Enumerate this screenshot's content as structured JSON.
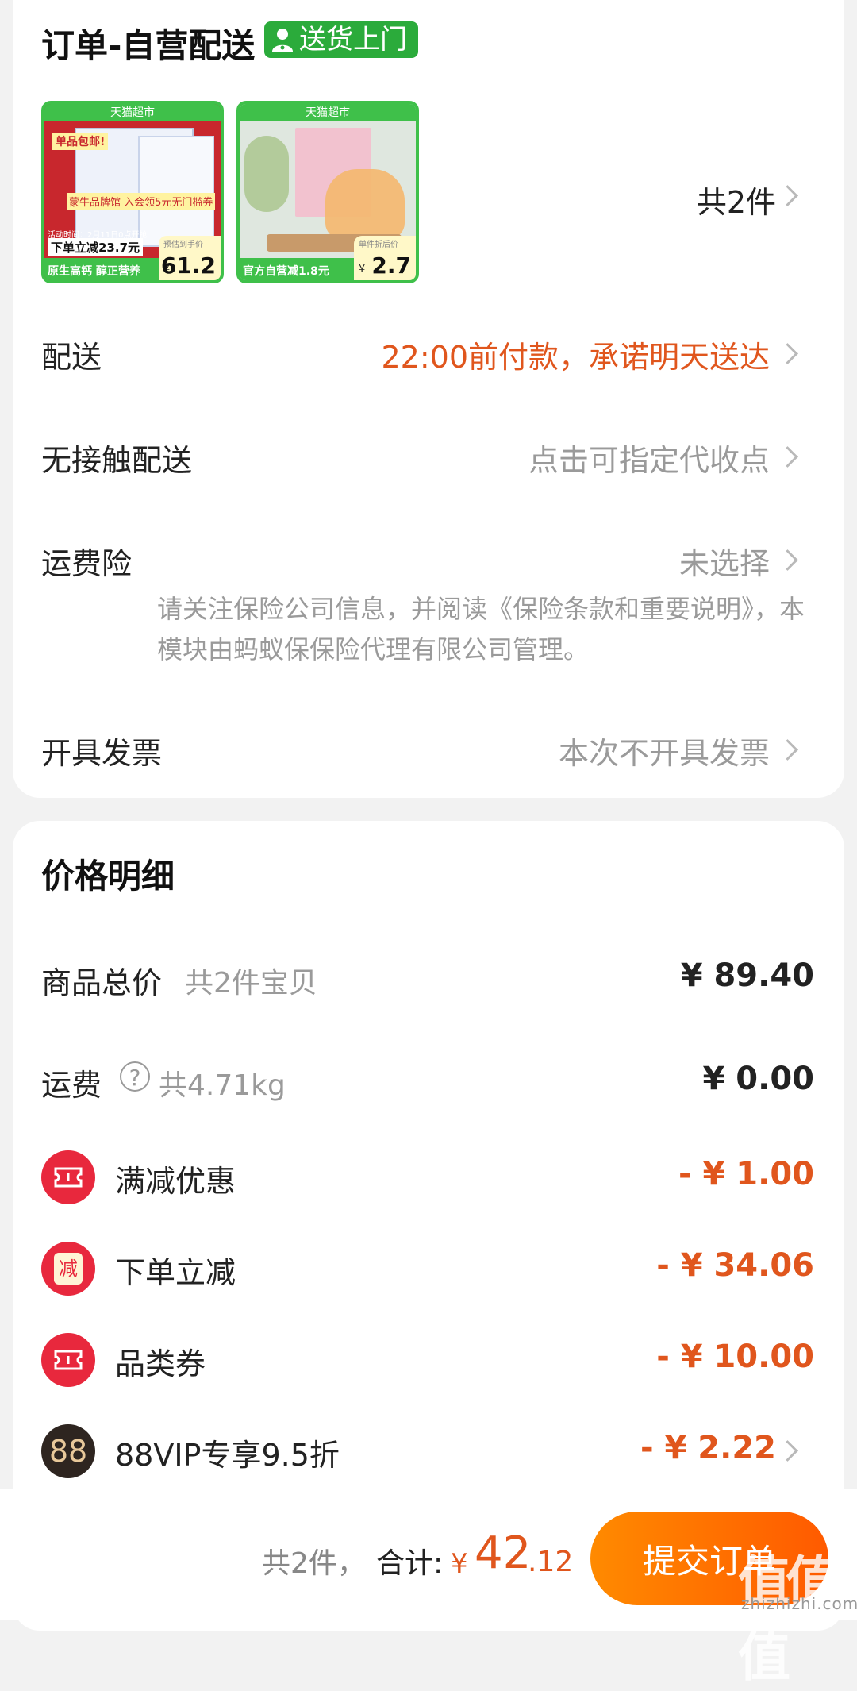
{
  "order": {
    "title": "订单-自营配送",
    "badge": "送货上门",
    "items_count": "共2件",
    "products": [
      {
        "header": "天猫超市",
        "promo": "单品包邮!",
        "slogan": "蒙牛品牌馆 入会领5元无门槛券",
        "activity": "活动时间：2月11日0点开抢",
        "cut": "下单立减23.7元",
        "footer": "原生高钙 醇正营养",
        "price_label": "预估到手价",
        "currency": "¥",
        "price": "61.2"
      },
      {
        "header": "天猫超市",
        "footer": "官方自营减1.8元",
        "price_label": "单件折后价",
        "currency": "¥",
        "price": "2.7"
      }
    ]
  },
  "rows": {
    "delivery": {
      "label": "配送",
      "value": "22:00前付款，承诺明天送达"
    },
    "contactless": {
      "label": "无接触配送",
      "value": "点击可指定代收点"
    },
    "insurance": {
      "label": "运费险",
      "value": "未选择",
      "note": "请关注保险公司信息，并阅读《保险条款和重要说明》，本模块由蚂蚁保保险代理有限公司管理。"
    },
    "invoice": {
      "label": "开具发票",
      "value": "本次不开具发票"
    }
  },
  "price_detail": {
    "title": "价格明细",
    "goods_total": {
      "label": "商品总价",
      "sub": "共2件宝贝",
      "amount": "¥ 89.40"
    },
    "shipping": {
      "label": "运费",
      "help_glyph": "?",
      "sub": "共4.71kg",
      "amount": "¥ 0.00"
    },
    "discounts": [
      {
        "label": "满减优惠",
        "amount": "- ¥ 1.00",
        "icon": "coupon-icon"
      },
      {
        "label": "下单立减",
        "amount": "- ¥ 34.06",
        "icon": "reduce-icon",
        "icon_text": "减"
      },
      {
        "label": "品类券",
        "amount": "- ¥ 10.00",
        "icon": "coupon-icon"
      },
      {
        "label": "88VIP专享9.5折",
        "amount": "- ¥ 2.22",
        "icon": "vip-88-icon",
        "icon_text": "88"
      }
    ]
  },
  "bottom_bar": {
    "count": "共2件，",
    "total_label": "合计:",
    "currency": "¥",
    "total_int": "42",
    "total_dec": ".12",
    "submit": "提交订单"
  },
  "watermark": {
    "text": "值值值",
    "sub": "zhizhizhi.com"
  },
  "colors": {
    "accent_orange": "#e0561d",
    "badge_green": "#2bab3b",
    "discount_red": "#e8283d"
  }
}
